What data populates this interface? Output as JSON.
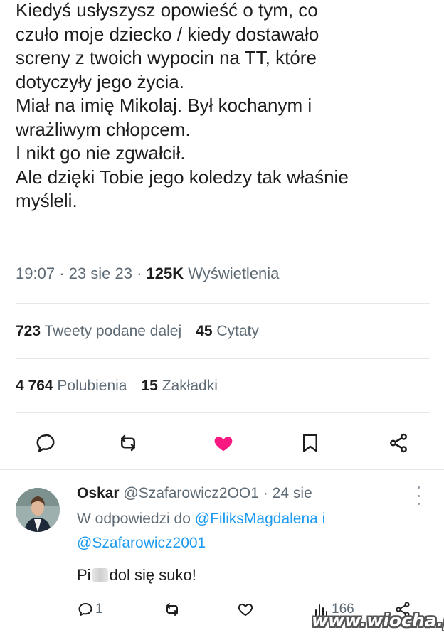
{
  "tweet": {
    "lines": [
      "Kiedyś usłyszysz opowieść o tym, co",
      "czuło moje dziecko / kiedy dostawało",
      "screny z twoich wypocin na TT, które",
      "dotyczyły jego życia.",
      "Miał na imię Mikolaj. Był kochanym i",
      "wrażliwym chłopcem.",
      "I nikt go nie zgwałcił.",
      "Ale dzięki Tobie jego koledzy tak właśnie",
      "myśleli."
    ],
    "time": "19:07",
    "date": "23 sie 23",
    "views_count": "125K",
    "views_label": "Wyświetlenia",
    "separator": "·"
  },
  "stats": {
    "retweets_count": "723",
    "retweets_label": "Tweety podane dalej",
    "quotes_count": "45",
    "quotes_label": "Cytaty",
    "likes_count": "4 764",
    "likes_label": "Polubienia",
    "bookmarks_count": "15",
    "bookmarks_label": "Zakładki"
  },
  "actions": {
    "icons": [
      "reply-icon",
      "retweet-icon",
      "heart-icon",
      "bookmark-icon",
      "share-icon"
    ],
    "liked_color": "#f91880",
    "icon_color": "#536471"
  },
  "reply": {
    "name": "Oskar",
    "handle": "@Szafarowicz2OO1",
    "separator": "·",
    "age": "24 sie",
    "in_reply_to_label": "W odpowiedzi do",
    "mention_1": "@FiliksMagdalena",
    "conjunction": "i",
    "mention_2": "@Szafarowicz2001",
    "body_start": "Pi",
    "body_end": "dol się suko!",
    "reply_count": "1",
    "views_count": "166",
    "mention_color": "#1d9bf0"
  },
  "watermark": "www.wiocha.pl"
}
